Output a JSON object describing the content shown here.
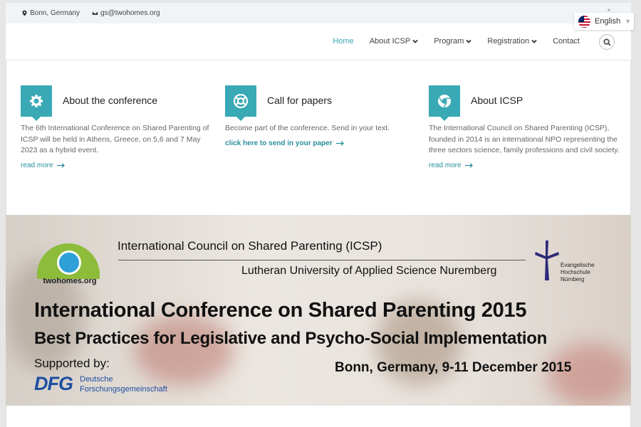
{
  "topbar": {
    "location": "Bonn, Germany",
    "email": "gs@twohomes.org",
    "close_label": "×"
  },
  "language": {
    "selected": "English"
  },
  "nav": {
    "items": [
      {
        "label": "Home",
        "active": true,
        "dropdown": false
      },
      {
        "label": "About ICSP",
        "dropdown": true
      },
      {
        "label": "Program",
        "dropdown": true
      },
      {
        "label": "Registration",
        "dropdown": true
      },
      {
        "label": "Contact",
        "dropdown": false
      }
    ]
  },
  "features": [
    {
      "icon": "gear-icon",
      "title": "About the conference",
      "text": "The 6th International Conference on Shared Parenting of ICSP will be held in Athens, Greece, on 5,6 and 7 May 2023 as a hybrid event.",
      "link": "read more"
    },
    {
      "icon": "lifebuoy-icon",
      "title": "Call for papers",
      "text": "Become part of the conference. Send in your text.",
      "link": "click here to send in your paper"
    },
    {
      "icon": "chrome-icon",
      "title": "About ICSP",
      "text": "The International Council on Shared Parenting (ICSP), founded in 2014 is an international NPO representing the three sectors science, family professions and civil society.",
      "link": "read more"
    }
  ],
  "banner": {
    "logo_left": "twohomes.org",
    "org_line": "International Council on Shared Parenting (ICSP)",
    "university_line": "Lutheran University of Applied Science Nuremberg",
    "logo_right_lines": [
      "Evangelische",
      "Hochschule",
      "Nürnberg"
    ],
    "title": "International Conference on Shared Parenting 2015",
    "subtitle": "Best Practices for Legislative and Psycho-Social Implementation",
    "supported_by": "Supported by:",
    "dfg_mark": "DFG",
    "dfg_name_lines": [
      "Deutsche",
      "Forschungsgemeinschaft"
    ],
    "location_date": "Bonn, Germany, 9-11 December 2015"
  },
  "colors": {
    "accent": "#3aa9b6",
    "link": "#2a8f9c",
    "topbar_bg": "#f1f4f6",
    "dfg_blue": "#1d4ea0",
    "logo_green": "#8cbc3a",
    "logo_blue": "#2f9fd8"
  }
}
